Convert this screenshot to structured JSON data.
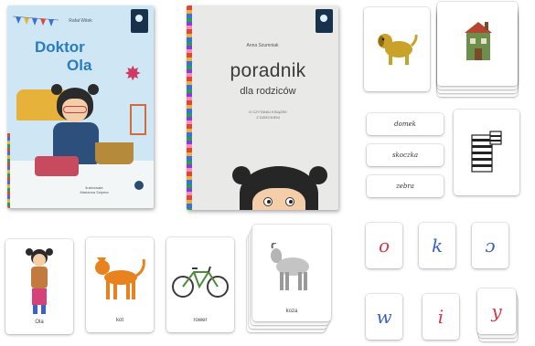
{
  "books": {
    "doktor_ola": {
      "author": "Rafał Witek",
      "title_line1": "Doktor",
      "title_line2": "Ola",
      "illustrator_credit": "ilustrowała\nMarianna Sztyma"
    },
    "poradnik": {
      "author": "Anna Szumniak",
      "title_line1": "poradnik",
      "title_line2": "dla rodziców",
      "subtitle": "O CZYTANIU KSIĄŻEK\nZ DZIECKIEM"
    }
  },
  "picture_cards": {
    "dog": "",
    "house": "",
    "zebra": "",
    "girl": "Ola",
    "cat": "kot",
    "bike": "rower",
    "goat": "koza"
  },
  "word_cards": [
    "domek",
    "skoczka",
    "zebra"
  ],
  "letter_cards": [
    {
      "letter": "o",
      "color": "#d8394a"
    },
    {
      "letter": "k",
      "color": "#3b62c8"
    },
    {
      "letter": "ɔ",
      "color": "#3b62c8"
    },
    {
      "letter": "w",
      "color": "#3b62c8"
    },
    {
      "letter": "i",
      "color": "#d8394a"
    },
    {
      "letter": "y",
      "color": "#d8394a"
    }
  ],
  "colors": {
    "vowel_red": "#d8394a",
    "consonant_blue": "#3b62c8"
  }
}
